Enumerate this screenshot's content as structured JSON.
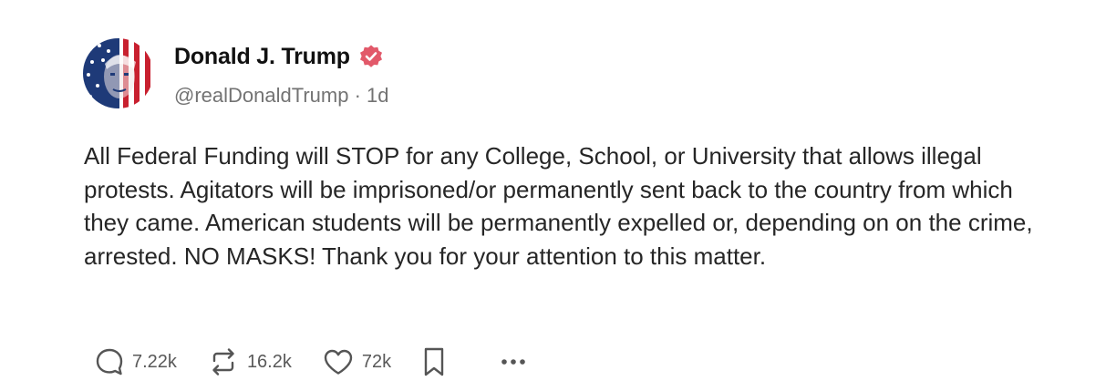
{
  "author": {
    "display_name": "Donald J. Trump",
    "handle_line": "@realDonaldTrump · 1d",
    "verified_icon": "verified-badge-icon",
    "badge_color": "#e2596a"
  },
  "post": {
    "text": "All Federal Funding will STOP for any College, School, or University that allows illegal protests. Agitators will be imprisoned/or permanently sent back to the country from which they came. American students will be permanently expelled or, depending on on the crime, arrested. NO MASKS! Thank you for your attention to this matter."
  },
  "actions": {
    "reply": {
      "icon": "reply-icon",
      "count": "7.22k"
    },
    "repost": {
      "icon": "repost-icon",
      "count": "16.2k"
    },
    "like": {
      "icon": "heart-icon",
      "count": "72k"
    },
    "bookmark": {
      "icon": "bookmark-icon"
    },
    "more": {
      "icon": "more-icon"
    }
  }
}
